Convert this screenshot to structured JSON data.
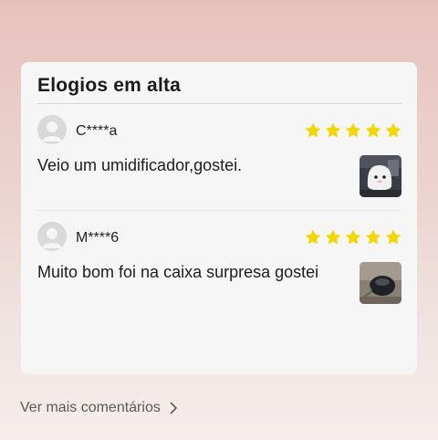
{
  "section": {
    "title": "Elogios em alta"
  },
  "reviews": [
    {
      "user": "C****a",
      "rating": 5,
      "text": "Veio um umidificador,gostei.",
      "photo_icon": "humidifier-photo"
    },
    {
      "user": "M****6",
      "rating": 5,
      "text": "Muito bom foi na caixa surpresa gostei",
      "photo_icon": "mouse-photo"
    }
  ],
  "footer": {
    "more_label": "Ver mais comentários"
  },
  "colors": {
    "star": "#f2d600",
    "accent_text": "#1a1a1a"
  }
}
